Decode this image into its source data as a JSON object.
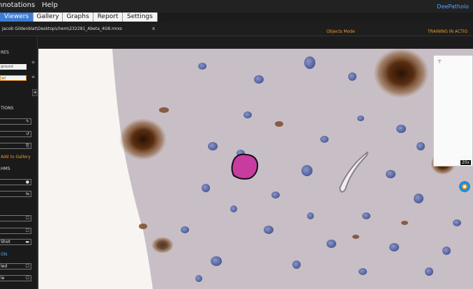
{
  "menu": {
    "items": [
      "nnotations",
      "Help"
    ],
    "brand": "DeePatholo"
  },
  "tabs": [
    {
      "label": "Viewers",
      "active": true
    },
    {
      "label": "Gallery",
      "active": false
    },
    {
      "label": "Graphs",
      "active": false
    },
    {
      "label": "Report",
      "active": false
    },
    {
      "label": "Settings",
      "active": false
    }
  ],
  "file": {
    "path": "Jacob Gildenblat\\Desktop\\chem\\232281_Abeta_4G8.mrxs",
    "close_label": "x",
    "mode": "Objects Mode",
    "training": "TRAINING IN ACTIO"
  },
  "sidebar": {
    "section_classes": "RES",
    "input_background": "ground",
    "input_current": "ell",
    "section_annotations": "TIONS",
    "buttons_annotations": [
      "",
      "",
      ""
    ],
    "icons_annotations": [
      "✎",
      "↺",
      "⎘"
    ],
    "add_to_gallery": "Add to Gallery",
    "section_algorithms": "HMS",
    "buttons_algorithms": [
      "",
      ""
    ],
    "icons_algorithms": [
      "●",
      "⇆"
    ],
    "section_export": "",
    "buttons_export": [
      "",
      "",
      "Shot"
    ],
    "icons_export": [
      "☐",
      "☐",
      "▬"
    ],
    "section_extra": "ON",
    "buttons_extra": [
      "led",
      "le"
    ],
    "icons_extra": [
      "☐",
      "☐"
    ],
    "scroll_icon": "◂",
    "side_icons": [
      "≡",
      "≡"
    ]
  },
  "viewer": {
    "background_color": "#c9c0c7",
    "tissue_edge_color": "#f7f4f2",
    "selected_object_color": "#c83ca0"
  },
  "minimap": {
    "zoom": "20x",
    "corner_icon": "⊤"
  },
  "colors": {
    "accent_blue": "#3f7ed6",
    "accent_orange": "#e89a2a",
    "brand_blue": "#4fa8ff"
  }
}
